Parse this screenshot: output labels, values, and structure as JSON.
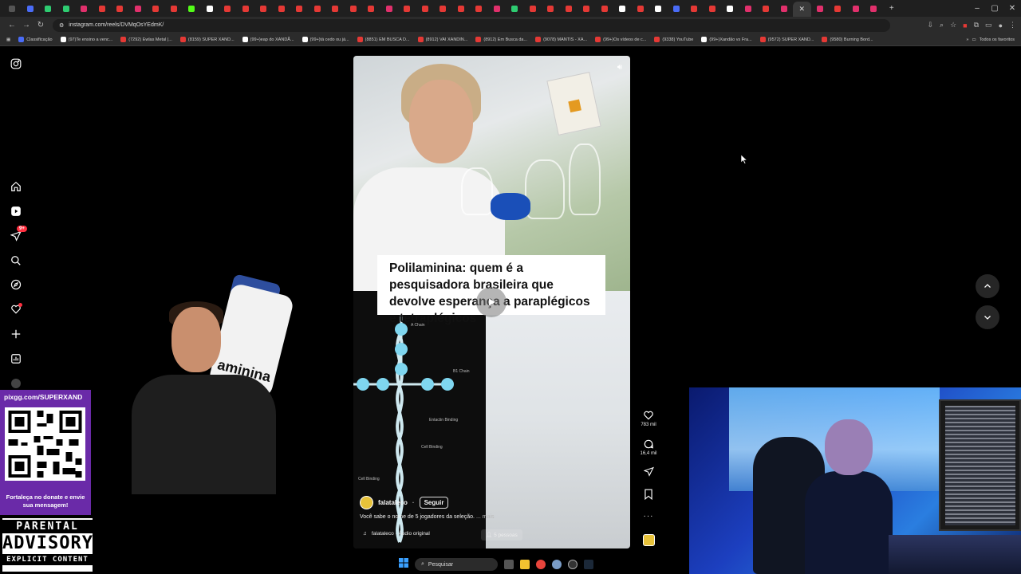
{
  "browser": {
    "url": "instagram.com/reels/DVMqOsYEdmK/",
    "bookmarks": [
      {
        "label": "Classificação",
        "color": "#4a6cf7"
      },
      {
        "label": "(97)Te ensino a venc...",
        "color": "#ffffff"
      },
      {
        "label": "(7292) Ewlas Metal |...",
        "color": "#e53935"
      },
      {
        "label": "(8159) SUPER XAND...",
        "color": "#e53935"
      },
      {
        "label": "(99+)eap do XANDÃ...",
        "color": "#ffffff"
      },
      {
        "label": "(99+)tá cedo ou já...",
        "color": "#ffffff"
      },
      {
        "label": "(8851) EM BUSCA D...",
        "color": "#e53935"
      },
      {
        "label": "(8912) VAI XANDIN...",
        "color": "#e53935"
      },
      {
        "label": "(8912) Em Busca da...",
        "color": "#e53935"
      },
      {
        "label": "(9078) MANTIS - XA...",
        "color": "#e53935"
      },
      {
        "label": "(99+)Os vídeos de c...",
        "color": "#e53935"
      },
      {
        "label": "(9338) YouTube",
        "color": "#e53935"
      },
      {
        "label": "(99+)Xandão vs Fra...",
        "color": "#ffffff"
      },
      {
        "label": "(9572) SUPER XAND...",
        "color": "#e53935"
      },
      {
        "label": "(9580) Burning Bord...",
        "color": "#e53935"
      }
    ],
    "all_bookmarks_label": "Todos os favoritos"
  },
  "sidebar": {
    "notification_badge": "9+"
  },
  "reel": {
    "caption_card": "Polilaminina: quem é a pesquisadora brasileira que devolve esperança a paraplégicos e tetraplégicos",
    "bottle_text": "aminina",
    "diagram_labels": [
      "A Chain",
      "B1 Chain",
      "Entactin Binding",
      "Cell Binding",
      "Cell Binding"
    ],
    "username": "falataleco",
    "follow_label": "Seguir",
    "description": "Você sabe o nome de 5 jogadores da seleção.",
    "more_label": "... mais",
    "audio_label": "falataleco · Áudio original",
    "people_label": "5 pessoas",
    "likes": "783 mil",
    "comments": "16,4 mil"
  },
  "overlay": {
    "qr_url": "pixgg.com/SUPERXAND",
    "qr_message": "Fortaleça no donate e envie sua mensagem!",
    "advisory_top": "PARENTAL",
    "advisory_mid": "ADVISORY",
    "advisory_bottom": "EXPLICIT CONTENT"
  },
  "taskbar": {
    "search_placeholder": "Pesquisar"
  }
}
